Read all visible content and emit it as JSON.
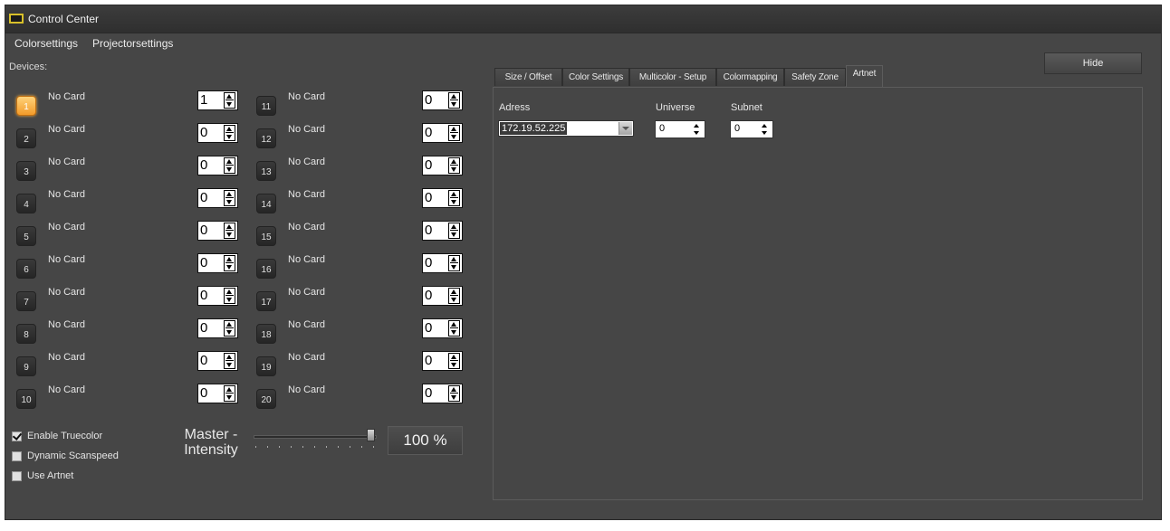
{
  "window": {
    "title": "Control Center",
    "icon": "monitor-icon"
  },
  "menu": {
    "items": [
      "Colorsettings",
      "Projectorsettings"
    ]
  },
  "devices": {
    "label": "Devices:",
    "left": [
      {
        "num": "1",
        "status": "No Card",
        "value": "1",
        "active": true
      },
      {
        "num": "2",
        "status": "No Card",
        "value": "0"
      },
      {
        "num": "3",
        "status": "No Card",
        "value": "0"
      },
      {
        "num": "4",
        "status": "No Card",
        "value": "0"
      },
      {
        "num": "5",
        "status": "No Card",
        "value": "0"
      },
      {
        "num": "6",
        "status": "No Card",
        "value": "0"
      },
      {
        "num": "7",
        "status": "No Card",
        "value": "0"
      },
      {
        "num": "8",
        "status": "No Card",
        "value": "0"
      },
      {
        "num": "9",
        "status": "No Card",
        "value": "0"
      },
      {
        "num": "10",
        "status": "No Card",
        "value": "0"
      }
    ],
    "right": [
      {
        "num": "11",
        "status": "No Card",
        "value": "0"
      },
      {
        "num": "12",
        "status": "No Card",
        "value": "0"
      },
      {
        "num": "13",
        "status": "No Card",
        "value": "0"
      },
      {
        "num": "14",
        "status": "No Card",
        "value": "0"
      },
      {
        "num": "15",
        "status": "No Card",
        "value": "0"
      },
      {
        "num": "16",
        "status": "No Card",
        "value": "0"
      },
      {
        "num": "17",
        "status": "No Card",
        "value": "0"
      },
      {
        "num": "18",
        "status": "No Card",
        "value": "0"
      },
      {
        "num": "19",
        "status": "No Card",
        "value": "0"
      },
      {
        "num": "20",
        "status": "No Card",
        "value": "0"
      }
    ]
  },
  "options": [
    {
      "label": "Enable Truecolor",
      "checked": true
    },
    {
      "label": "Dynamic Scanspeed",
      "checked": false
    },
    {
      "label": "Use Artnet",
      "checked": false
    }
  ],
  "master": {
    "label_line1": "Master -",
    "label_line2": "Intensity",
    "percent": "100 %",
    "level": 1.0
  },
  "hide_button": "Hide",
  "tabs": {
    "items": [
      "Size / Offset",
      "Color Settings",
      "Multicolor - Setup",
      "Colormapping",
      "Safety Zone",
      "Artnet"
    ],
    "active": "Artnet"
  },
  "artnet": {
    "address_label": "Adress",
    "address_value": "172.19.52.225",
    "universe_label": "Universe",
    "universe_value": "0",
    "subnet_label": "Subnet",
    "subnet_value": "0"
  },
  "colors": {
    "active_device": "#f29b2a",
    "background": "#464646",
    "titlebar": "#2f2f2f"
  }
}
